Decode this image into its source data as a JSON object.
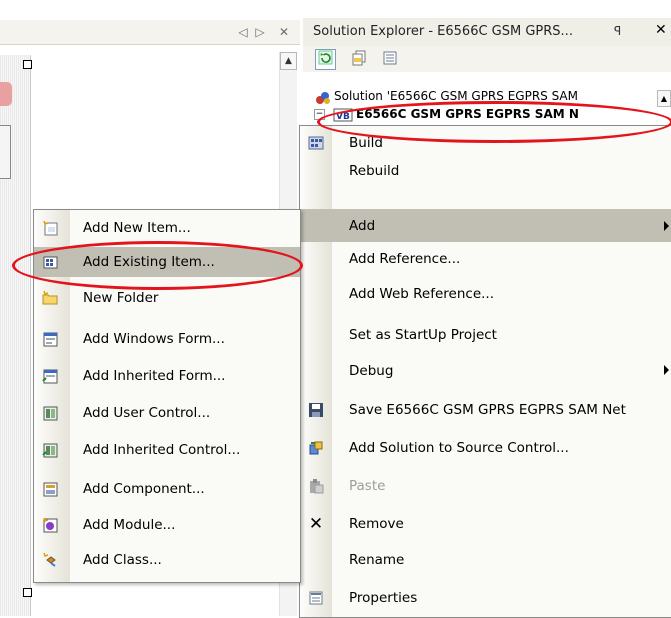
{
  "left_pane": {
    "nav_prev": "◁",
    "nav_next": "▷",
    "close": "✕"
  },
  "solution_explorer": {
    "title": "Solution Explorer - E6566C GSM GPRS...",
    "pin": "ꟼ",
    "close": "✕",
    "toolbar": [
      "refresh-icon",
      "show-all-files-icon",
      "properties-icon"
    ],
    "tree": {
      "solution_label": "Solution 'E6566C GSM GPRS EGPRS SAM",
      "project_label": "E6566C GSM GPRS EGPRS SAM N"
    }
  },
  "context_menu": {
    "items": [
      {
        "label": "Build",
        "icon": "build-icon"
      },
      {
        "label": "Rebuild",
        "icon": ""
      },
      {
        "label": "Add",
        "icon": "",
        "submenu": true,
        "highlighted": true
      },
      {
        "label": "Add Reference...",
        "icon": ""
      },
      {
        "label": "Add Web Reference...",
        "icon": ""
      },
      {
        "label": "Set as StartUp Project",
        "icon": ""
      },
      {
        "label": "Debug",
        "icon": "",
        "submenu": true
      },
      {
        "label": "Save E6566C GSM GPRS EGPRS SAM Net",
        "icon": "save-icon"
      },
      {
        "label": "Add Solution to Source Control...",
        "icon": "source-control-icon"
      },
      {
        "label": "Paste",
        "icon": "paste-icon",
        "disabled": true
      },
      {
        "label": "Remove",
        "icon": "remove-icon"
      },
      {
        "label": "Rename",
        "icon": ""
      },
      {
        "label": "Properties",
        "icon": "properties-icon"
      }
    ]
  },
  "add_submenu": {
    "items": [
      {
        "label": "Add New Item...",
        "icon": "new-item-icon"
      },
      {
        "label": "Add Existing Item...",
        "icon": "existing-item-icon",
        "highlighted": true
      },
      {
        "label": "New Folder",
        "icon": "folder-icon"
      },
      {
        "label": "Add Windows Form...",
        "icon": "windows-form-icon"
      },
      {
        "label": "Add Inherited Form...",
        "icon": "inherited-form-icon"
      },
      {
        "label": "Add User Control...",
        "icon": "user-control-icon"
      },
      {
        "label": "Add Inherited Control...",
        "icon": "inherited-control-icon"
      },
      {
        "label": "Add Component...",
        "icon": "component-icon"
      },
      {
        "label": "Add Module...",
        "icon": "module-icon"
      },
      {
        "label": "Add Class...",
        "icon": "class-icon"
      }
    ]
  },
  "colors": {
    "highlight": "#c1bfb3",
    "annotation": "#e3141b"
  }
}
